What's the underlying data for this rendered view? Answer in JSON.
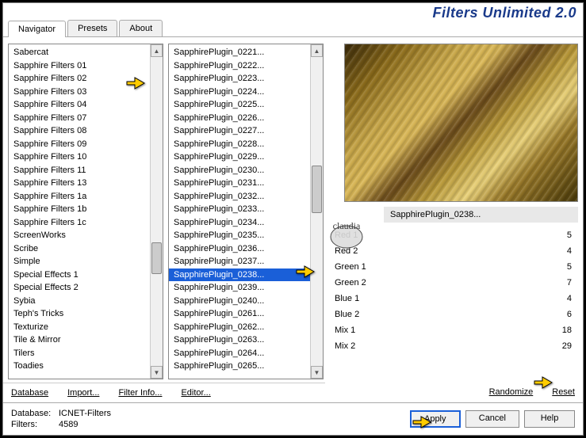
{
  "header": {
    "title": "Filters Unlimited 2.0"
  },
  "tabs": [
    "Navigator",
    "Presets",
    "About"
  ],
  "activeTab": 0,
  "list1": [
    "Sabercat",
    "Sapphire Filters 01",
    "Sapphire Filters 02",
    "Sapphire Filters 03",
    "Sapphire Filters 04",
    "Sapphire Filters 07",
    "Sapphire Filters 08",
    "Sapphire Filters 09",
    "Sapphire Filters 10",
    "Sapphire Filters 11",
    "Sapphire Filters 13",
    "Sapphire Filters 1a",
    "Sapphire Filters 1b",
    "Sapphire Filters 1c",
    "ScreenWorks",
    "Scribe",
    "Simple",
    "Special Effects 1",
    "Special Effects 2",
    "Sybia",
    "Teph's Tricks",
    "Texturize",
    "Tile & Mirror",
    "Tilers",
    "Toadies"
  ],
  "list1SelectedIndex": 3,
  "list2": [
    "SapphirePlugin_0221...",
    "SapphirePlugin_0222...",
    "SapphirePlugin_0223...",
    "SapphirePlugin_0224...",
    "SapphirePlugin_0225...",
    "SapphirePlugin_0226...",
    "SapphirePlugin_0227...",
    "SapphirePlugin_0228...",
    "SapphirePlugin_0229...",
    "SapphirePlugin_0230...",
    "SapphirePlugin_0231...",
    "SapphirePlugin_0232...",
    "SapphirePlugin_0233...",
    "SapphirePlugin_0234...",
    "SapphirePlugin_0235...",
    "SapphirePlugin_0236...",
    "SapphirePlugin_0237...",
    "SapphirePlugin_0238...",
    "SapphirePlugin_0239...",
    "SapphirePlugin_0240...",
    "SapphirePlugin_0261...",
    "SapphirePlugin_0262...",
    "SapphirePlugin_0263...",
    "SapphirePlugin_0264...",
    "SapphirePlugin_0265..."
  ],
  "list2SelectedIndex": 17,
  "currentPlugin": "SapphirePlugin_0238...",
  "params": [
    {
      "name": "Red 1",
      "value": 5
    },
    {
      "name": "Red 2",
      "value": 4
    },
    {
      "name": "Green 1",
      "value": 5
    },
    {
      "name": "Green 2",
      "value": 7
    },
    {
      "name": "Blue 1",
      "value": 4
    },
    {
      "name": "Blue 2",
      "value": 6
    },
    {
      "name": "Mix 1",
      "value": 18
    },
    {
      "name": "Mix 2",
      "value": 29
    }
  ],
  "toolbarLeft": {
    "database": "Database",
    "import": "Import...",
    "filterInfo": "Filter Info...",
    "editor": "Editor..."
  },
  "toolbarRight": {
    "randomize": "Randomize",
    "reset": "Reset"
  },
  "footer": {
    "dbLabel": "Database:",
    "dbValue": "ICNET-Filters",
    "filtersLabel": "Filters:",
    "filtersValue": "4589"
  },
  "buttons": {
    "apply": "Apply",
    "cancel": "Cancel",
    "help": "Help"
  },
  "watermark": "claudia"
}
